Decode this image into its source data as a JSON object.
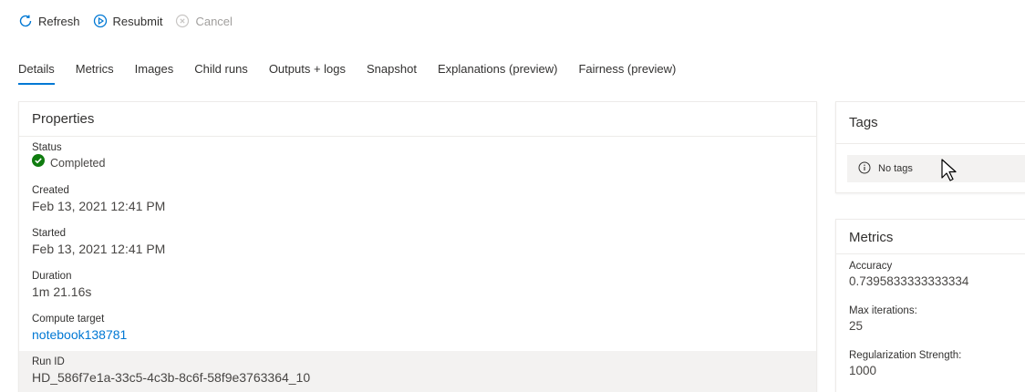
{
  "toolbar": {
    "refresh_label": "Refresh",
    "resubmit_label": "Resubmit",
    "cancel_label": "Cancel"
  },
  "tabs": [
    {
      "label": "Details",
      "active": true
    },
    {
      "label": "Metrics"
    },
    {
      "label": "Images"
    },
    {
      "label": "Child runs"
    },
    {
      "label": "Outputs + logs"
    },
    {
      "label": "Snapshot"
    },
    {
      "label": "Explanations (preview)"
    },
    {
      "label": "Fairness (preview)"
    }
  ],
  "properties": {
    "title": "Properties",
    "status_label": "Status",
    "status_value": "Completed",
    "created_label": "Created",
    "created_value": "Feb 13, 2021 12:41 PM",
    "started_label": "Started",
    "started_value": "Feb 13, 2021 12:41 PM",
    "duration_label": "Duration",
    "duration_value": "1m 21.16s",
    "compute_label": "Compute target",
    "compute_value": "notebook138781",
    "runid_label": "Run ID",
    "runid_value": "HD_586f7e1a-33c5-4c3b-8c6f-58f9e3763364_10"
  },
  "tags": {
    "title": "Tags",
    "empty_text": "No tags"
  },
  "metrics": {
    "title": "Metrics",
    "items": [
      {
        "label": "Accuracy",
        "value": "0.7395833333333334"
      },
      {
        "label": "Max iterations:",
        "value": "25"
      },
      {
        "label": "Regularization Strength:",
        "value": "1000"
      }
    ]
  },
  "colors": {
    "accent": "#0078d4",
    "success": "#107c10"
  }
}
